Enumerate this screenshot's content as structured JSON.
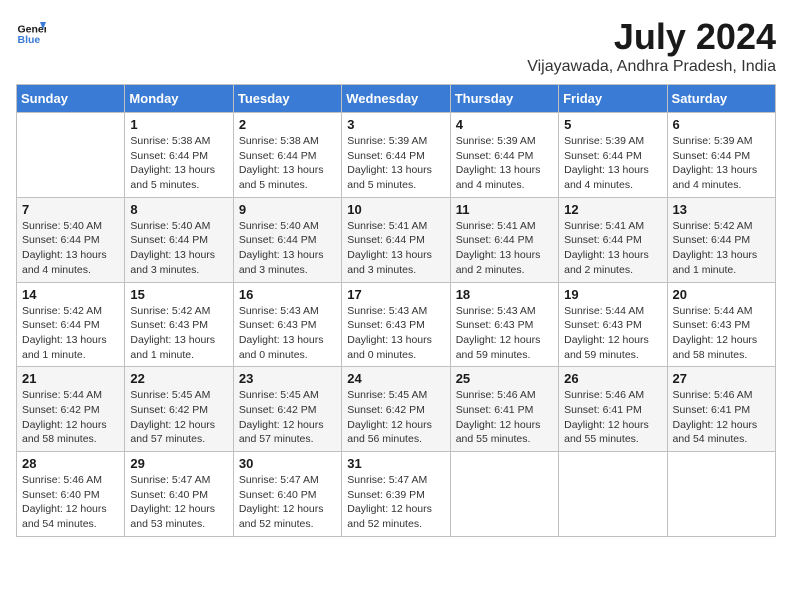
{
  "header": {
    "logo_line1": "General",
    "logo_line2": "Blue",
    "month": "July 2024",
    "location": "Vijayawada, Andhra Pradesh, India"
  },
  "weekdays": [
    "Sunday",
    "Monday",
    "Tuesday",
    "Wednesday",
    "Thursday",
    "Friday",
    "Saturday"
  ],
  "weeks": [
    [
      {
        "day": "",
        "info": ""
      },
      {
        "day": "1",
        "info": "Sunrise: 5:38 AM\nSunset: 6:44 PM\nDaylight: 13 hours\nand 5 minutes."
      },
      {
        "day": "2",
        "info": "Sunrise: 5:38 AM\nSunset: 6:44 PM\nDaylight: 13 hours\nand 5 minutes."
      },
      {
        "day": "3",
        "info": "Sunrise: 5:39 AM\nSunset: 6:44 PM\nDaylight: 13 hours\nand 5 minutes."
      },
      {
        "day": "4",
        "info": "Sunrise: 5:39 AM\nSunset: 6:44 PM\nDaylight: 13 hours\nand 4 minutes."
      },
      {
        "day": "5",
        "info": "Sunrise: 5:39 AM\nSunset: 6:44 PM\nDaylight: 13 hours\nand 4 minutes."
      },
      {
        "day": "6",
        "info": "Sunrise: 5:39 AM\nSunset: 6:44 PM\nDaylight: 13 hours\nand 4 minutes."
      }
    ],
    [
      {
        "day": "7",
        "info": "Sunrise: 5:40 AM\nSunset: 6:44 PM\nDaylight: 13 hours\nand 4 minutes."
      },
      {
        "day": "8",
        "info": "Sunrise: 5:40 AM\nSunset: 6:44 PM\nDaylight: 13 hours\nand 3 minutes."
      },
      {
        "day": "9",
        "info": "Sunrise: 5:40 AM\nSunset: 6:44 PM\nDaylight: 13 hours\nand 3 minutes."
      },
      {
        "day": "10",
        "info": "Sunrise: 5:41 AM\nSunset: 6:44 PM\nDaylight: 13 hours\nand 3 minutes."
      },
      {
        "day": "11",
        "info": "Sunrise: 5:41 AM\nSunset: 6:44 PM\nDaylight: 13 hours\nand 2 minutes."
      },
      {
        "day": "12",
        "info": "Sunrise: 5:41 AM\nSunset: 6:44 PM\nDaylight: 13 hours\nand 2 minutes."
      },
      {
        "day": "13",
        "info": "Sunrise: 5:42 AM\nSunset: 6:44 PM\nDaylight: 13 hours\nand 1 minute."
      }
    ],
    [
      {
        "day": "14",
        "info": "Sunrise: 5:42 AM\nSunset: 6:44 PM\nDaylight: 13 hours\nand 1 minute."
      },
      {
        "day": "15",
        "info": "Sunrise: 5:42 AM\nSunset: 6:43 PM\nDaylight: 13 hours\nand 1 minute."
      },
      {
        "day": "16",
        "info": "Sunrise: 5:43 AM\nSunset: 6:43 PM\nDaylight: 13 hours\nand 0 minutes."
      },
      {
        "day": "17",
        "info": "Sunrise: 5:43 AM\nSunset: 6:43 PM\nDaylight: 13 hours\nand 0 minutes."
      },
      {
        "day": "18",
        "info": "Sunrise: 5:43 AM\nSunset: 6:43 PM\nDaylight: 12 hours\nand 59 minutes."
      },
      {
        "day": "19",
        "info": "Sunrise: 5:44 AM\nSunset: 6:43 PM\nDaylight: 12 hours\nand 59 minutes."
      },
      {
        "day": "20",
        "info": "Sunrise: 5:44 AM\nSunset: 6:43 PM\nDaylight: 12 hours\nand 58 minutes."
      }
    ],
    [
      {
        "day": "21",
        "info": "Sunrise: 5:44 AM\nSunset: 6:42 PM\nDaylight: 12 hours\nand 58 minutes."
      },
      {
        "day": "22",
        "info": "Sunrise: 5:45 AM\nSunset: 6:42 PM\nDaylight: 12 hours\nand 57 minutes."
      },
      {
        "day": "23",
        "info": "Sunrise: 5:45 AM\nSunset: 6:42 PM\nDaylight: 12 hours\nand 57 minutes."
      },
      {
        "day": "24",
        "info": "Sunrise: 5:45 AM\nSunset: 6:42 PM\nDaylight: 12 hours\nand 56 minutes."
      },
      {
        "day": "25",
        "info": "Sunrise: 5:46 AM\nSunset: 6:41 PM\nDaylight: 12 hours\nand 55 minutes."
      },
      {
        "day": "26",
        "info": "Sunrise: 5:46 AM\nSunset: 6:41 PM\nDaylight: 12 hours\nand 55 minutes."
      },
      {
        "day": "27",
        "info": "Sunrise: 5:46 AM\nSunset: 6:41 PM\nDaylight: 12 hours\nand 54 minutes."
      }
    ],
    [
      {
        "day": "28",
        "info": "Sunrise: 5:46 AM\nSunset: 6:40 PM\nDaylight: 12 hours\nand 54 minutes."
      },
      {
        "day": "29",
        "info": "Sunrise: 5:47 AM\nSunset: 6:40 PM\nDaylight: 12 hours\nand 53 minutes."
      },
      {
        "day": "30",
        "info": "Sunrise: 5:47 AM\nSunset: 6:40 PM\nDaylight: 12 hours\nand 52 minutes."
      },
      {
        "day": "31",
        "info": "Sunrise: 5:47 AM\nSunset: 6:39 PM\nDaylight: 12 hours\nand 52 minutes."
      },
      {
        "day": "",
        "info": ""
      },
      {
        "day": "",
        "info": ""
      },
      {
        "day": "",
        "info": ""
      }
    ]
  ]
}
